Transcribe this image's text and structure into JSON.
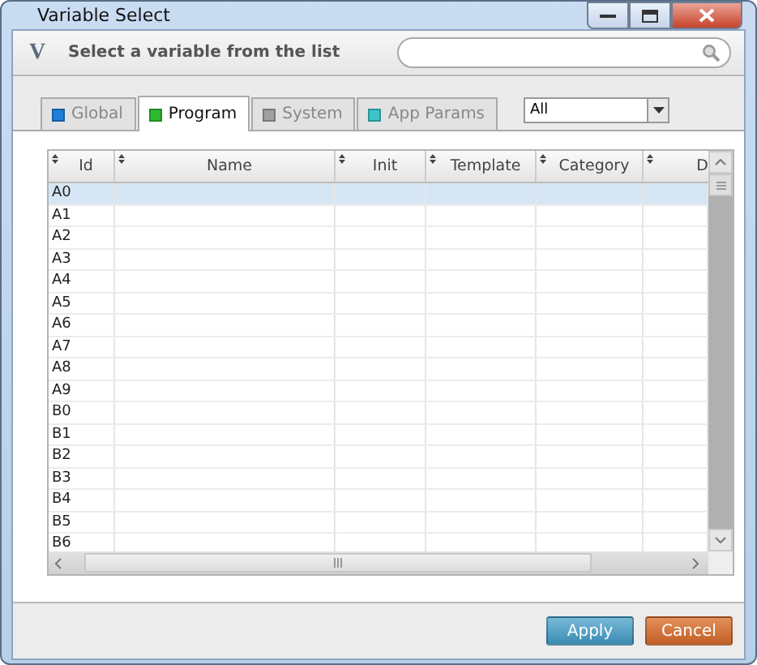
{
  "window": {
    "title": "Variable Select"
  },
  "header": {
    "logo": "V",
    "prompt": "Select a variable from the list"
  },
  "tabs": [
    {
      "label": "Global",
      "selected": false,
      "color": "#1f7fd6"
    },
    {
      "label": "Program",
      "selected": true,
      "color": "#2dbb2d"
    },
    {
      "label": "System",
      "selected": false,
      "color": "#a0a0a0"
    },
    {
      "label": "App Params",
      "selected": false,
      "color": "#3cc4c8"
    }
  ],
  "filter": {
    "value": "All"
  },
  "table": {
    "columns": [
      "Id",
      "Name",
      "Init",
      "Template",
      "Category",
      "D"
    ],
    "rows": [
      {
        "id": "A0",
        "selected": true
      },
      {
        "id": "A1",
        "selected": false
      },
      {
        "id": "A2",
        "selected": false
      },
      {
        "id": "A3",
        "selected": false
      },
      {
        "id": "A4",
        "selected": false
      },
      {
        "id": "A5",
        "selected": false
      },
      {
        "id": "A6",
        "selected": false
      },
      {
        "id": "A7",
        "selected": false
      },
      {
        "id": "A8",
        "selected": false
      },
      {
        "id": "A9",
        "selected": false
      },
      {
        "id": "B0",
        "selected": false
      },
      {
        "id": "B1",
        "selected": false
      },
      {
        "id": "B2",
        "selected": false
      },
      {
        "id": "B3",
        "selected": false
      },
      {
        "id": "B4",
        "selected": false
      },
      {
        "id": "B5",
        "selected": false
      },
      {
        "id": "B6",
        "selected": false
      }
    ]
  },
  "buttons": [
    {
      "label": "Apply",
      "kind": "primary"
    },
    {
      "label": "Cancel",
      "kind": "danger"
    }
  ]
}
